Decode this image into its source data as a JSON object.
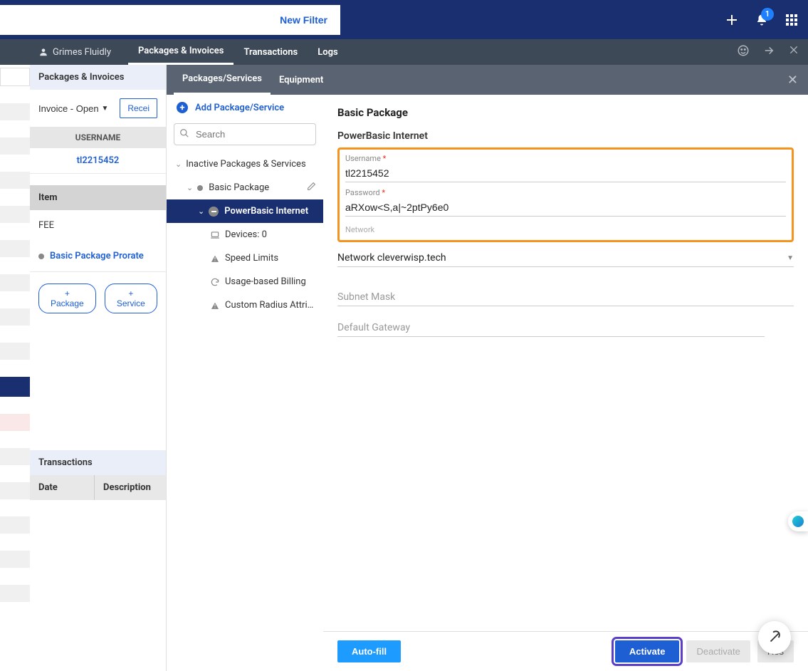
{
  "topHeader": {
    "newFilter": "New Filter",
    "notifCount": "1"
  },
  "secondaryNav": {
    "user": "Grimes Fluidly",
    "tabs": [
      "Packages & Invoices",
      "Transactions",
      "Logs"
    ],
    "activeTab": 0
  },
  "piSidebar": {
    "title": "Packages & Invoices",
    "invoiceBtn": "Invoice - Open",
    "receiBtn": "Recei",
    "usernameHeader": "USERNAME",
    "usernameValue": "tl2215452",
    "itemHeader": "Item",
    "fee": "FEE",
    "basicPackage": "Basic Package Prorate",
    "addPackageBtn": "+ Package",
    "addServiceBtn": "+ Service",
    "transHeader": "Transactions",
    "tableCols": {
      "date": "Date",
      "desc": "Description"
    }
  },
  "tree": {
    "tabs": [
      "Packages/Services",
      "Equipment"
    ],
    "activeTab": 0,
    "addLabel": "Add Package/Service",
    "searchPlaceholder": "Search",
    "root": "Inactive Packages & Services",
    "level2": "Basic Package",
    "level3": "PowerBasic Internet",
    "level4": [
      {
        "icon": "laptop",
        "label": "Devices: 0"
      },
      {
        "icon": "warn",
        "label": "Speed Limits"
      },
      {
        "icon": "cycle",
        "label": "Usage-based Billing"
      },
      {
        "icon": "warn",
        "label": "Custom Radius Attri…"
      }
    ]
  },
  "form": {
    "title": "Basic Package",
    "subTitle": "PowerBasic Internet",
    "usernameLabel": "Username",
    "usernameValue": "tl2215452",
    "passwordLabel": "Password",
    "passwordValue": "aRXow<S,a|~2ptPy6e0",
    "networkTruncLabel": "Network",
    "networkLabel": "Network",
    "networkValue": "cleverwisp.tech",
    "subnetLabel": "Subnet Mask",
    "gatewayLabel": "Default Gateway",
    "autoFillBtn": "Auto-fill",
    "activateBtn": "Activate",
    "deactivateBtn": "Deactivate",
    "resetBtn": "Res"
  }
}
